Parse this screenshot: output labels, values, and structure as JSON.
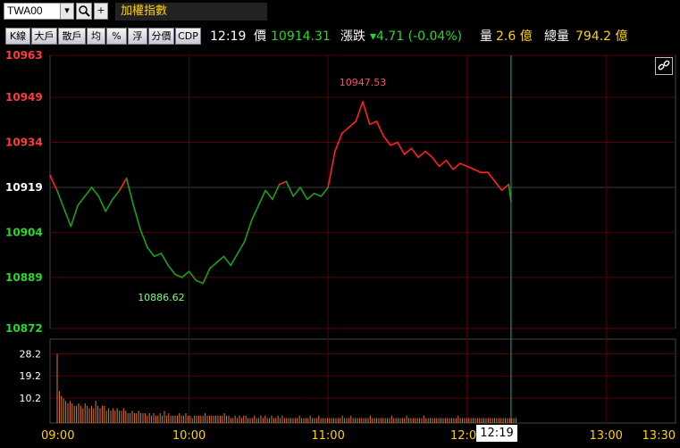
{
  "symbol": {
    "code": "TWA00",
    "name": "加權指數"
  },
  "toolbar": [
    "K線",
    "大戶",
    "散戶",
    "均",
    "%",
    "浮",
    "分價",
    "CDP"
  ],
  "quote": {
    "time": "12:19",
    "price_label": "價",
    "price": "10914.31",
    "change_label": "漲跌",
    "change": "▾4.71 (-0.04%)",
    "vol_label": "量",
    "vol": "2.6 億",
    "total_label": "總量",
    "total": "794.2 億"
  },
  "colors": {
    "up": "#ff2020",
    "down": "#1aa01a",
    "up_label": "#ff3b3b",
    "down_label": "#26d926",
    "axis_time": "#ffd200",
    "grid": "#5a0000",
    "volume": "#e07a2a"
  },
  "chart_data": {
    "type": "line",
    "title": "",
    "xlabel": "",
    "ylabel": "",
    "x_ticks": [
      "09:00",
      "10:00",
      "11:00",
      "12:00",
      "13:00",
      "13:30"
    ],
    "y_ticks": [
      {
        "value": 10963,
        "dir": "up"
      },
      {
        "value": 10949,
        "dir": "up"
      },
      {
        "value": 10934,
        "dir": "up"
      },
      {
        "value": 10919,
        "dir": "ref"
      },
      {
        "value": 10904,
        "dir": "down"
      },
      {
        "value": 10889,
        "dir": "down"
      },
      {
        "value": 10872,
        "dir": "down"
      }
    ],
    "ylim": [
      10872,
      10963
    ],
    "reference": 10919,
    "cursor_time": "12:19",
    "annotations": [
      {
        "text": "10947.53",
        "time": "11:15",
        "value": 10947.53,
        "color": "up"
      },
      {
        "text": "10886.62",
        "time": "09:48",
        "value": 10886.62,
        "color": "down"
      }
    ],
    "series": [
      {
        "points": [
          [
            "09:00",
            10923
          ],
          [
            "09:03",
            10918
          ],
          [
            "09:06",
            10912
          ],
          [
            "09:09",
            10906
          ],
          [
            "09:12",
            10913
          ],
          [
            "09:15",
            10916
          ],
          [
            "09:18",
            10919
          ],
          [
            "09:21",
            10916
          ],
          [
            "09:24",
            10911
          ],
          [
            "09:27",
            10915
          ],
          [
            "09:30",
            10918
          ],
          [
            "09:33",
            10922
          ],
          [
            "09:36",
            10913
          ],
          [
            "09:39",
            10905
          ],
          [
            "09:42",
            10899
          ],
          [
            "09:45",
            10896
          ],
          [
            "09:48",
            10897
          ],
          [
            "09:51",
            10893
          ],
          [
            "09:54",
            10890
          ],
          [
            "09:57",
            10889
          ],
          [
            "10:00",
            10891
          ],
          [
            "10:03",
            10888
          ],
          [
            "10:06",
            10887
          ],
          [
            "10:09",
            10892
          ],
          [
            "10:12",
            10894
          ],
          [
            "10:15",
            10896
          ],
          [
            "10:18",
            10893
          ],
          [
            "10:21",
            10897
          ],
          [
            "10:24",
            10901
          ],
          [
            "10:27",
            10908
          ],
          [
            "10:30",
            10913
          ],
          [
            "10:33",
            10918
          ],
          [
            "10:36",
            10915
          ],
          [
            "10:39",
            10920
          ],
          [
            "10:42",
            10921
          ],
          [
            "10:45",
            10916
          ],
          [
            "10:48",
            10919
          ],
          [
            "10:51",
            10915
          ],
          [
            "10:54",
            10917
          ],
          [
            "10:57",
            10916
          ],
          [
            "11:00",
            10919
          ],
          [
            "11:03",
            10931
          ],
          [
            "11:06",
            10937
          ],
          [
            "11:09",
            10939
          ],
          [
            "11:12",
            10941
          ],
          [
            "11:15",
            10947.5
          ],
          [
            "11:18",
            10940
          ],
          [
            "11:21",
            10941
          ],
          [
            "11:24",
            10936
          ],
          [
            "11:27",
            10933
          ],
          [
            "11:30",
            10934
          ],
          [
            "11:33",
            10930
          ],
          [
            "11:36",
            10932
          ],
          [
            "11:39",
            10929
          ],
          [
            "11:42",
            10931
          ],
          [
            "11:45",
            10929
          ],
          [
            "11:48",
            10926
          ],
          [
            "11:51",
            10928
          ],
          [
            "11:54",
            10925
          ],
          [
            "11:57",
            10927
          ],
          [
            "12:00",
            10926
          ],
          [
            "12:03",
            10925
          ],
          [
            "12:06",
            10924
          ],
          [
            "12:09",
            10924
          ],
          [
            "12:12",
            10921
          ],
          [
            "12:15",
            10918
          ],
          [
            "12:18",
            10920
          ],
          [
            "12:19",
            10914.31
          ]
        ]
      }
    ],
    "volume": {
      "y_ticks": [
        28.2,
        19.2,
        10.2
      ],
      "ylim": [
        0,
        32
      ],
      "unit": "億",
      "values": [
        28.2,
        13,
        11,
        10,
        9,
        8,
        9,
        8,
        7,
        7,
        8,
        7,
        6,
        8,
        7,
        6,
        7,
        6,
        9,
        7,
        6,
        7,
        7,
        5,
        6,
        5,
        6,
        5,
        6,
        5,
        5,
        6,
        5,
        4,
        4,
        5,
        4,
        4,
        5,
        4,
        4,
        4,
        3,
        4,
        3,
        4,
        3,
        3,
        4,
        3,
        5,
        3,
        4,
        3,
        3,
        3,
        3,
        4,
        3,
        3,
        4,
        3,
        3,
        2,
        3,
        3,
        3,
        3,
        3,
        4,
        3,
        3,
        3,
        3,
        3,
        3,
        3,
        3,
        4,
        3,
        3,
        2,
        2,
        3,
        2,
        3,
        2,
        3,
        3,
        2,
        2,
        2,
        3,
        2,
        2,
        3,
        2,
        3,
        2,
        2,
        3,
        2,
        2,
        3,
        2,
        3,
        2,
        2,
        2,
        2,
        2,
        2,
        2,
        3,
        2,
        2,
        2,
        2,
        3,
        2,
        2,
        2,
        3,
        2,
        2,
        2,
        2,
        2,
        2,
        2,
        2,
        2,
        2,
        3,
        2,
        2,
        2,
        3,
        2,
        2,
        2,
        2,
        2,
        2,
        2,
        2,
        3,
        2,
        2,
        2,
        2,
        2,
        2,
        2,
        2,
        2,
        3,
        2,
        2,
        2,
        2,
        2,
        2,
        3,
        2,
        2,
        2,
        2,
        2,
        2,
        2,
        3,
        2,
        2,
        2,
        2,
        2,
        2,
        2,
        2,
        2,
        2,
        2,
        2,
        2,
        2,
        2,
        3,
        2,
        2,
        2,
        2,
        2,
        2,
        2,
        2,
        2,
        2,
        2,
        2,
        2,
        2,
        2,
        2,
        2,
        2,
        2,
        2,
        2,
        2,
        2,
        2,
        2,
        2,
        2
      ]
    }
  }
}
